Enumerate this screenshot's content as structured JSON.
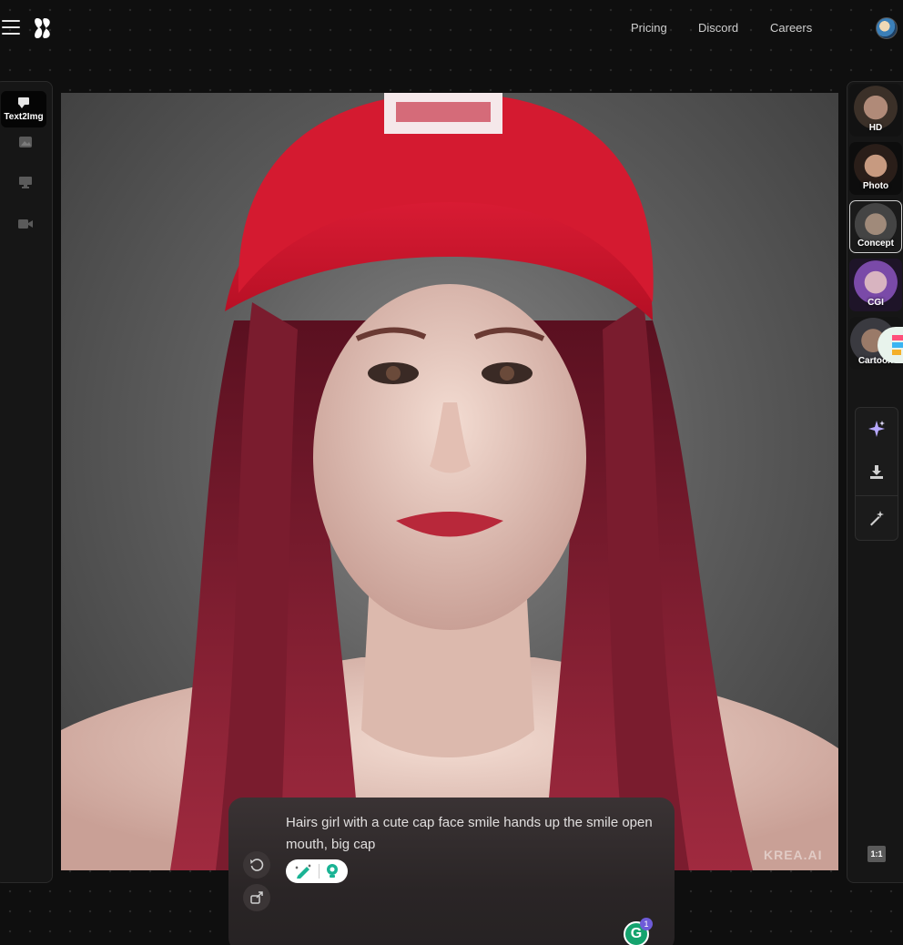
{
  "header": {
    "nav": [
      "Pricing",
      "Discord",
      "Careers"
    ]
  },
  "left_toolbar": {
    "active_tool_label": "Text2Img",
    "tools": [
      "text2img-icon",
      "image-icon",
      "monitor-icon",
      "video-icon"
    ]
  },
  "canvas": {
    "watermark": "KREA.AI"
  },
  "styles": [
    {
      "label": "HD",
      "selected": false
    },
    {
      "label": "Photo",
      "selected": false
    },
    {
      "label": "Concept",
      "selected": true
    },
    {
      "label": "CGI",
      "selected": false
    },
    {
      "label": "Cartoon",
      "selected": false
    }
  ],
  "actions": [
    "sparkle-icon",
    "download-icon",
    "magic-wand-icon"
  ],
  "aspect_ratio": "1:1",
  "prompt": {
    "text": "Hairs girl with a cute cap face smile hands up the smile open mouth, big cap"
  },
  "grammarly": {
    "badge_count": "1"
  },
  "colors": {
    "background": "#0f0f0f",
    "panel": "#161616",
    "accent_red": "#d8182b",
    "hair": "#7a1c2e"
  }
}
